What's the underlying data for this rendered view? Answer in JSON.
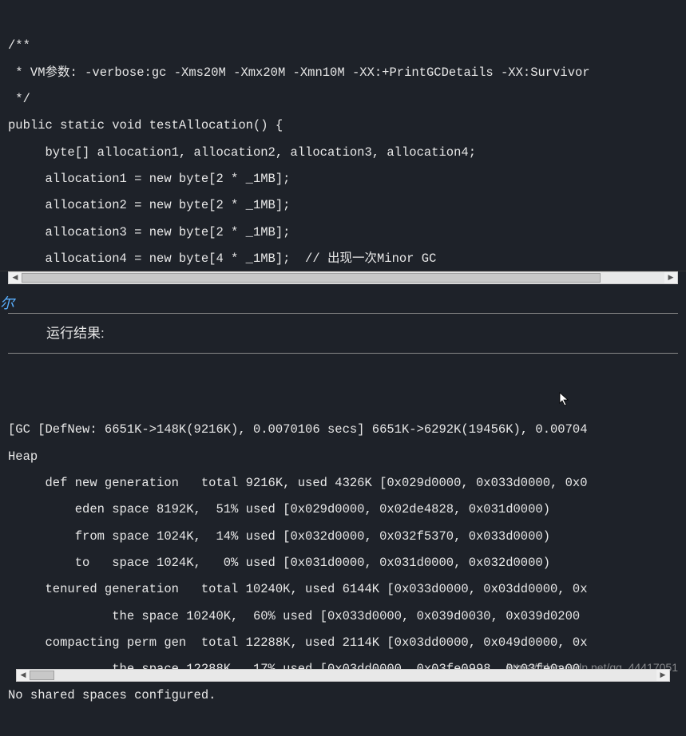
{
  "code": {
    "lines": [
      "/**",
      " * VM参数: -verbose:gc -Xms20M -Xmx20M -Xmn10M -XX:+PrintGCDetails -XX:Survivor",
      " */",
      "public static void testAllocation() {",
      "     byte[] allocation1, allocation2, allocation3, allocation4;",
      "     allocation1 = new byte[2 * _1MB];",
      "     allocation2 = new byte[2 * _1MB];",
      "     allocation3 = new byte[2 * _1MB];",
      "     allocation4 = new byte[4 * _1MB];  // 出现一次Minor GC",
      " }"
    ]
  },
  "fragment": "尔",
  "run_label": "运行结果:",
  "output": {
    "lines": [
      "[GC [DefNew: 6651K->148K(9216K), 0.0070106 secs] 6651K->6292K(19456K), 0.00704",
      "Heap",
      "     def new generation   total 9216K, used 4326K [0x029d0000, 0x033d0000, 0x0",
      "         eden space 8192K,  51% used [0x029d0000, 0x02de4828, 0x031d0000)",
      "         from space 1024K,  14% used [0x032d0000, 0x032f5370, 0x033d0000)",
      "         to   space 1024K,   0% used [0x031d0000, 0x031d0000, 0x032d0000)",
      "     tenured generation   total 10240K, used 6144K [0x033d0000, 0x03dd0000, 0x",
      "              the space 10240K,  60% used [0x033d0000, 0x039d0030, 0x039d0200",
      "     compacting perm gen  total 12288K, used 2114K [0x03dd0000, 0x049d0000, 0x",
      "              the space 12288K,  17% used [0x03dd0000, 0x03fe0998, 0x03fe0a00",
      "No shared spaces configured."
    ]
  },
  "watermark": "https://blog.csdn.net/qq_44417051"
}
